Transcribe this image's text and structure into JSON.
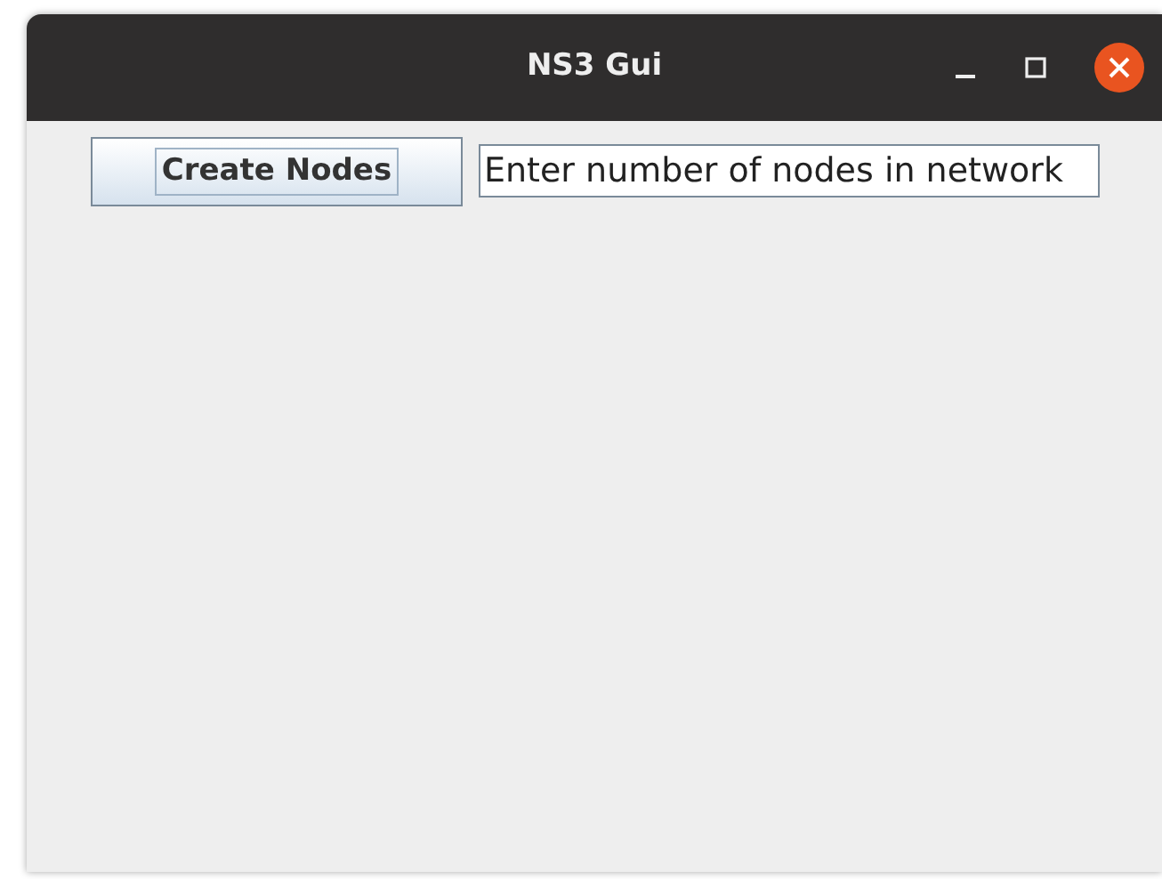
{
  "window": {
    "title": "NS3 Gui"
  },
  "create_button": {
    "label": "Create Nodes",
    "focused": true
  },
  "nodes_field": {
    "value": "Enter number of nodes in network"
  }
}
